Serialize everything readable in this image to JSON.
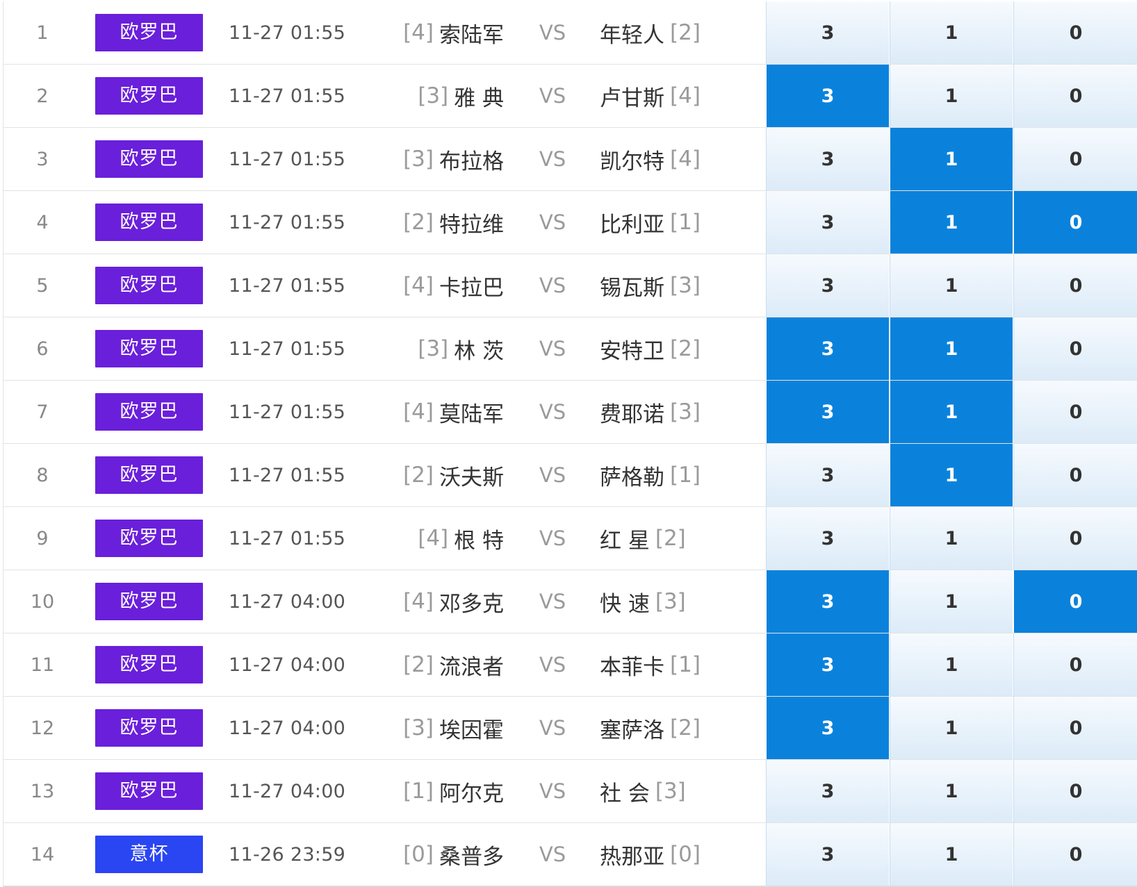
{
  "colors": {
    "league_europa": "#6a1fdb",
    "league_italy_cup": "#2a45f2",
    "odds_selected": "#0a82dc"
  },
  "matches": [
    {
      "idx": "1",
      "league": "欧罗巴",
      "league_color": "#6a1fdb",
      "time": "11-27 01:55",
      "home_rank": "[4]",
      "home": "索陆军",
      "vs": "VS",
      "away": "年轻人",
      "away_rank": "[2]",
      "odds": [
        "3",
        "1",
        "0"
      ],
      "selected": [
        false,
        false,
        false
      ]
    },
    {
      "idx": "2",
      "league": "欧罗巴",
      "league_color": "#6a1fdb",
      "time": "11-27 01:55",
      "home_rank": "[3]",
      "home": "雅 典",
      "vs": "VS",
      "away": "卢甘斯",
      "away_rank": "[4]",
      "odds": [
        "3",
        "1",
        "0"
      ],
      "selected": [
        true,
        false,
        false
      ]
    },
    {
      "idx": "3",
      "league": "欧罗巴",
      "league_color": "#6a1fdb",
      "time": "11-27 01:55",
      "home_rank": "[3]",
      "home": "布拉格",
      "vs": "VS",
      "away": "凯尔特",
      "away_rank": "[4]",
      "odds": [
        "3",
        "1",
        "0"
      ],
      "selected": [
        false,
        true,
        false
      ]
    },
    {
      "idx": "4",
      "league": "欧罗巴",
      "league_color": "#6a1fdb",
      "time": "11-27 01:55",
      "home_rank": "[2]",
      "home": "特拉维",
      "vs": "VS",
      "away": "比利亚",
      "away_rank": "[1]",
      "odds": [
        "3",
        "1",
        "0"
      ],
      "selected": [
        false,
        true,
        true
      ]
    },
    {
      "idx": "5",
      "league": "欧罗巴",
      "league_color": "#6a1fdb",
      "time": "11-27 01:55",
      "home_rank": "[4]",
      "home": "卡拉巴",
      "vs": "VS",
      "away": "锡瓦斯",
      "away_rank": "[3]",
      "odds": [
        "3",
        "1",
        "0"
      ],
      "selected": [
        false,
        false,
        false
      ]
    },
    {
      "idx": "6",
      "league": "欧罗巴",
      "league_color": "#6a1fdb",
      "time": "11-27 01:55",
      "home_rank": "[3]",
      "home": "林 茨",
      "vs": "VS",
      "away": "安特卫",
      "away_rank": "[2]",
      "odds": [
        "3",
        "1",
        "0"
      ],
      "selected": [
        true,
        true,
        false
      ]
    },
    {
      "idx": "7",
      "league": "欧罗巴",
      "league_color": "#6a1fdb",
      "time": "11-27 01:55",
      "home_rank": "[4]",
      "home": "莫陆军",
      "vs": "VS",
      "away": "费耶诺",
      "away_rank": "[3]",
      "odds": [
        "3",
        "1",
        "0"
      ],
      "selected": [
        true,
        true,
        false
      ]
    },
    {
      "idx": "8",
      "league": "欧罗巴",
      "league_color": "#6a1fdb",
      "time": "11-27 01:55",
      "home_rank": "[2]",
      "home": "沃夫斯",
      "vs": "VS",
      "away": "萨格勒",
      "away_rank": "[1]",
      "odds": [
        "3",
        "1",
        "0"
      ],
      "selected": [
        false,
        true,
        false
      ]
    },
    {
      "idx": "9",
      "league": "欧罗巴",
      "league_color": "#6a1fdb",
      "time": "11-27 01:55",
      "home_rank": "[4]",
      "home": "根 特",
      "vs": "VS",
      "away": "红 星",
      "away_rank": "[2]",
      "odds": [
        "3",
        "1",
        "0"
      ],
      "selected": [
        false,
        false,
        false
      ]
    },
    {
      "idx": "10",
      "league": "欧罗巴",
      "league_color": "#6a1fdb",
      "time": "11-27 04:00",
      "home_rank": "[4]",
      "home": "邓多克",
      "vs": "VS",
      "away": "快 速",
      "away_rank": "[3]",
      "odds": [
        "3",
        "1",
        "0"
      ],
      "selected": [
        true,
        false,
        true
      ]
    },
    {
      "idx": "11",
      "league": "欧罗巴",
      "league_color": "#6a1fdb",
      "time": "11-27 04:00",
      "home_rank": "[2]",
      "home": "流浪者",
      "vs": "VS",
      "away": "本菲卡",
      "away_rank": "[1]",
      "odds": [
        "3",
        "1",
        "0"
      ],
      "selected": [
        true,
        false,
        false
      ]
    },
    {
      "idx": "12",
      "league": "欧罗巴",
      "league_color": "#6a1fdb",
      "time": "11-27 04:00",
      "home_rank": "[3]",
      "home": "埃因霍",
      "vs": "VS",
      "away": "塞萨洛",
      "away_rank": "[2]",
      "odds": [
        "3",
        "1",
        "0"
      ],
      "selected": [
        true,
        false,
        false
      ]
    },
    {
      "idx": "13",
      "league": "欧罗巴",
      "league_color": "#6a1fdb",
      "time": "11-27 04:00",
      "home_rank": "[1]",
      "home": "阿尔克",
      "vs": "VS",
      "away": "社 会",
      "away_rank": "[3]",
      "odds": [
        "3",
        "1",
        "0"
      ],
      "selected": [
        false,
        false,
        false
      ]
    },
    {
      "idx": "14",
      "league": "意杯",
      "league_color": "#2a45f2",
      "time": "11-26 23:59",
      "home_rank": "[0]",
      "home": "桑普多",
      "vs": "VS",
      "away": "热那亚",
      "away_rank": "[0]",
      "odds": [
        "3",
        "1",
        "0"
      ],
      "selected": [
        false,
        false,
        false
      ]
    }
  ]
}
